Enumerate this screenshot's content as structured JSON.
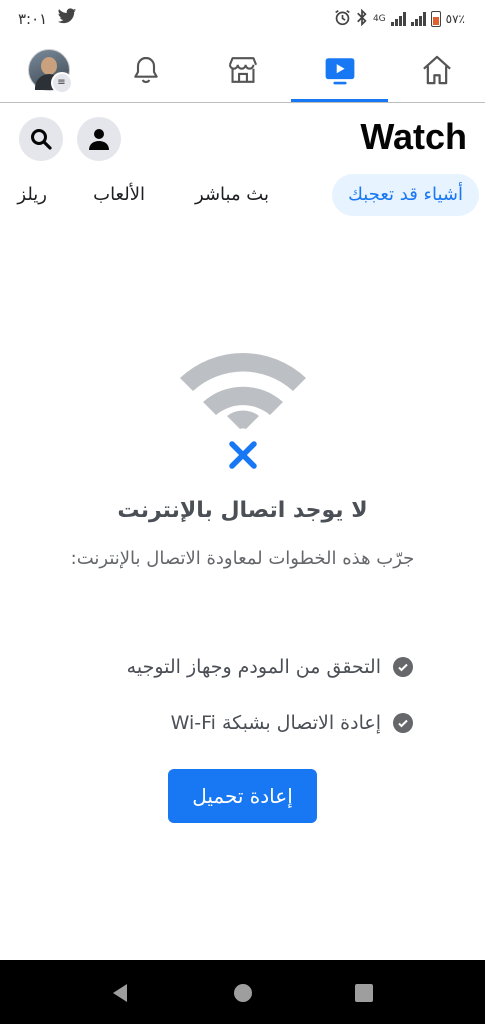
{
  "status_bar": {
    "time": "٣:٠١",
    "network": "4G",
    "battery": "٥٧٪",
    "icons": [
      "twitter-icon",
      "alarm-icon",
      "bluetooth-icon",
      "signal-icon",
      "battery-icon"
    ]
  },
  "top_nav": {
    "items": [
      "profile-menu",
      "notifications",
      "marketplace",
      "watch",
      "home"
    ],
    "active": "watch"
  },
  "header": {
    "title": "Watch"
  },
  "tabs": [
    {
      "label": "أشياء قد تعجبك",
      "active": true
    },
    {
      "label": "بث مباشر",
      "active": false
    },
    {
      "label": "الألعاب",
      "active": false
    },
    {
      "label": "ريلز",
      "active": false
    }
  ],
  "empty_state": {
    "title": "لا يوجد اتصال بالإنترنت",
    "description": "جرّب هذه الخطوات لمعاودة الاتصال بالإنترنت:",
    "steps": [
      "التحقق من المودم وجهاز التوجيه",
      "إعادة الاتصال بشبكة Wi-Fi"
    ],
    "reload_button": "إعادة تحميل"
  },
  "colors": {
    "accent": "#1877f2",
    "tab_active_bg": "#e7f3ff",
    "icon_button_bg": "#e4e6eb",
    "wifi_gray": "#bcc0c4"
  }
}
